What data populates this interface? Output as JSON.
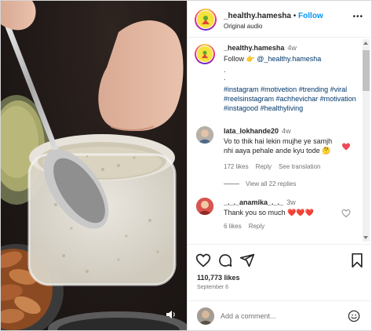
{
  "colors": {
    "link_blue": "#0095f6",
    "tag_blue": "#00376b",
    "heart_red": "#ed4956",
    "muted_text": "#737373"
  },
  "header": {
    "username": "_healthy.hamesha",
    "separator": "•",
    "follow_label": "Follow",
    "audio": "Original audio",
    "more_icon": "more-horizontal-icon"
  },
  "caption": {
    "username": "_healthy.hamesha",
    "time": "4w",
    "follow_text": "Follow 👉 ",
    "mention": "@_healthy.hamesha",
    "dot1": ".",
    "dot2": ".",
    "tags": [
      "#instagram",
      "#motivetion",
      "#trending",
      "#viral",
      "#reelsinstagram",
      "#achhevichar",
      "#motivation",
      "#instagood",
      "#healthyliving"
    ]
  },
  "comments": [
    {
      "username": "lata_lokhande20",
      "time": "4w",
      "text": "Vo to thik hai lekin mujhe ye samjh nhi aaya pehale ande kyu tode 🤔",
      "likes": "172 likes",
      "reply_label": "Reply",
      "translation_label": "See translation",
      "liked": true,
      "view_replies": "View all 22 replies"
    },
    {
      "username": "_._._anamika_._._",
      "time": "3w",
      "text": "Thank you so much ❤️❤️❤️",
      "likes": "6 likes",
      "reply_label": "Reply",
      "liked": false
    }
  ],
  "actions": {
    "icons": [
      "heart-icon",
      "comment-icon",
      "share-icon",
      "bookmark-icon"
    ],
    "likes": "110,773 likes",
    "date": "September 6"
  },
  "add_comment": {
    "placeholder": "Add a comment...",
    "emoji_icon": "smiley-icon"
  },
  "media": {
    "mute_icon": "volume-icon"
  }
}
